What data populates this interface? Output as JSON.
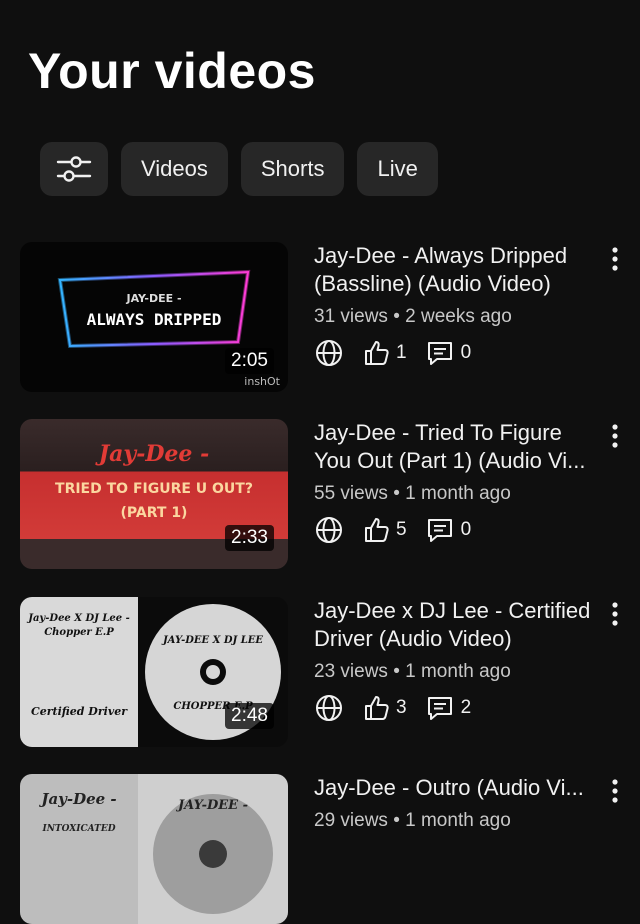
{
  "page": {
    "title": "Your videos"
  },
  "chips": [
    {
      "icon": "filter-sliders-icon"
    },
    {
      "label": "Videos"
    },
    {
      "label": "Shorts"
    },
    {
      "label": "Live"
    }
  ],
  "videos": [
    {
      "title": "Jay-Dee - Always Dripped (Bassline) (Audio Video)",
      "meta": "31 views • 2 weeks ago",
      "likes": "1",
      "comments": "0",
      "duration": "2:05",
      "thumb": {
        "line1": "JAY-DEE -",
        "line2": "ALWAYS DRIPPED",
        "watermark": "inshOt"
      }
    },
    {
      "title": "Jay-Dee - Tried To Figure You Out (Part 1) (Audio Vi...",
      "meta": "55 views • 1 month ago",
      "likes": "5",
      "comments": "0",
      "duration": "2:33",
      "thumb": {
        "line1": "Jay-Dee -",
        "line2": "TRIED TO FIGURE U OUT?",
        "line3": "(PART 1)"
      }
    },
    {
      "title": "Jay-Dee x DJ Lee - Certified Driver (Audio Video)",
      "meta": "23 views • 1 month ago",
      "likes": "3",
      "comments": "2",
      "duration": "2:48",
      "thumb": {
        "line1": "Jay-Dee X DJ Lee -",
        "line2": "Chopper E.P",
        "line3": "Certified Driver",
        "disc_top": "JAY-DEE X DJ LEE",
        "disc_bottom": "CHOPPER E.P"
      }
    },
    {
      "title": "Jay-Dee - Outro (Audio Vi...",
      "meta": "29 views • 1 month ago",
      "thumb": {
        "line1": "Jay-Dee -",
        "line2": "INTOXICATED",
        "disc_top": "JAY-DEE -"
      }
    }
  ],
  "colors": {
    "background": "#0f0f0f",
    "chip": "#272727",
    "text": "#f1f1f1",
    "meta": "#c8c8c8"
  }
}
